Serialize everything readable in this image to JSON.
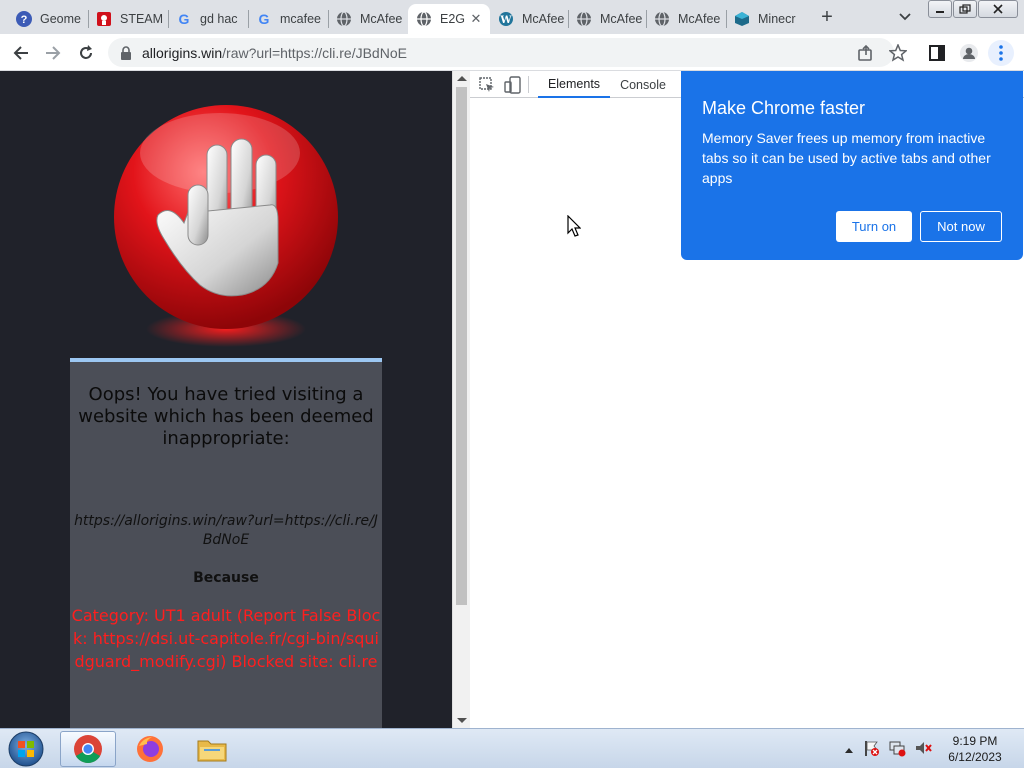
{
  "browser": {
    "tabs": [
      {
        "label": "Geome",
        "icon": "help-icon"
      },
      {
        "label": "STEAM",
        "icon": "steam-icon"
      },
      {
        "label": "gd hac",
        "icon": "google-icon"
      },
      {
        "label": "mcafee",
        "icon": "google-icon"
      },
      {
        "label": "McAfee",
        "icon": "globe-icon"
      },
      {
        "label": "E2G",
        "icon": "globe-icon",
        "active": true
      },
      {
        "label": "McAfee",
        "icon": "wordpress-icon"
      },
      {
        "label": "McAfee",
        "icon": "globe-icon"
      },
      {
        "label": "McAfee",
        "icon": "globe-icon"
      },
      {
        "label": "Minecr",
        "icon": "minecraft-icon"
      }
    ],
    "address": {
      "host": "allorigins.win",
      "path": "/raw?url=https://cli.re/JBdNoE"
    }
  },
  "page": {
    "title": "Oops! You have tried visiting a website which has been deemed inappropriate:",
    "blocked_url": "https://allorigins.win/raw?url=https://cli.re/JBdNoE",
    "because": "Because",
    "reason": "Category: UT1 adult (Report False Block: https://dsi.ut-capitole.fr/cgi-bin/squidguard_modify.cgi) Blocked site: cli.re"
  },
  "devtools": {
    "tabs": [
      "Elements",
      "Console"
    ],
    "active_tab": "Elements"
  },
  "promo": {
    "title": "Make Chrome faster",
    "body": "Memory Saver frees up memory from inactive tabs so it can be used by active tabs and other apps",
    "turn_on": "Turn on",
    "not_now": "Not now"
  },
  "taskbar": {
    "time": "9:19 PM",
    "date": "6/12/2023"
  },
  "colors": {
    "promo_blue": "#1a73e8",
    "blocked_text_red": "#ff1e1e",
    "page_bg": "#20222a",
    "card_bg": "#4b4e57"
  }
}
